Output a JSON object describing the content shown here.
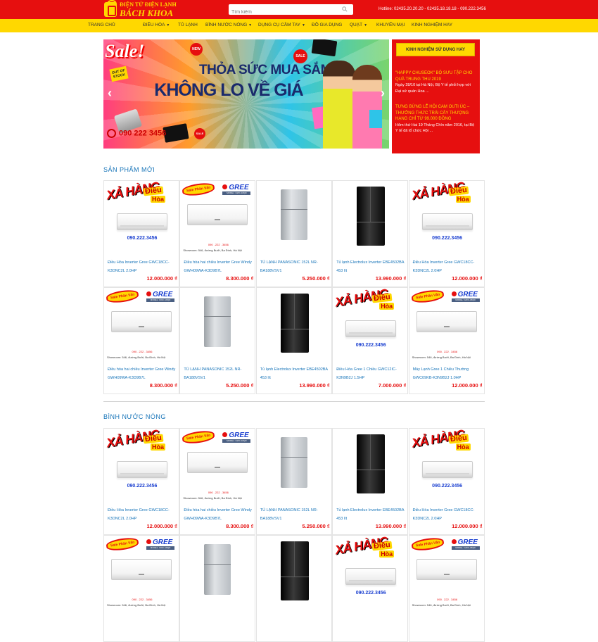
{
  "header": {
    "logo_line1": "ĐIỆN TỬ ĐIỆN LẠNH",
    "logo_line2": "BÁCH KHOA",
    "search_placeholder": "Tìm kiếm",
    "hotline": "Hotline: 02435.20.20.20 - 02435.18.18.18 - 090.222.3456"
  },
  "nav": [
    {
      "label": "Trang chủ",
      "caret": false
    },
    {
      "label": "Điều hòa",
      "caret": true
    },
    {
      "label": "Tủ lạnh",
      "caret": false
    },
    {
      "label": "Bình nước nóng",
      "caret": true
    },
    {
      "label": "Dụng cụ cầm tay",
      "caret": true
    },
    {
      "label": "Đồ gia dụng",
      "caret": false
    },
    {
      "label": "Quạt",
      "caret": true
    },
    {
      "label": "Khuyến mại",
      "caret": false
    },
    {
      "label": "Kinh nghiệm hay",
      "caret": false
    }
  ],
  "banner": {
    "sale": "Sale!",
    "out_of_stock": "OUT OF STOCK",
    "new": "NEW",
    "sale_badge": "SALE",
    "headline1": "THỎA SỨC MUA SẮM",
    "headline2": "KHÔNG LO VỀ GIÁ",
    "phone": "090 222 3456",
    "prev": "‹",
    "next": "›"
  },
  "sidebar": {
    "title": "Kinh nghiệm sử dụng hay",
    "news": [
      {
        "title": "\"Happy Chuseok\" bộ sưu tập cho quà Trung thu 2019",
        "desc": "Ngày 28/10 tại Hà Nội, Bộ Y tế phối hợp với Đại sứ quán Hoa ..."
      },
      {
        "title": "Tưng bừng lễ hội cam Outi Úc – thưởng thức trái cây thượng hạng chỉ từ 99.000 đồng",
        "desc": "Hôm thứ Hai 19 Tháng Chín năm 2016, tại Bộ Y tế đã tổ chức Hội ..."
      }
    ]
  },
  "sections": [
    {
      "title": "Sản phẩm mới",
      "products": [
        {
          "img": "promo",
          "name": "Điều Hòa Inverter Gree GWC18CC-K3DNC2L 2.0HP",
          "price": "12.000.000 ₫"
        },
        {
          "img": "gree-sale",
          "name": "Điều hòa hai chiều Inverter Gree Windy GWH09WA-K3D9B7L",
          "price": "8.300.000 ₫"
        },
        {
          "img": "fridge-silver",
          "name": "TỦ LẠNH PANASONIC 152L NR-BA188VSV1",
          "price": "5.250.000 ₫"
        },
        {
          "img": "fridge-black",
          "name": "Tủ lạnh Electrolux Inverter EBE4502BA 453 lít",
          "price": "13.990.000 ₫"
        },
        {
          "img": "promo",
          "name": "Điều Hòa Inverter Gree GWC18CC-K3DNC2L 2.0HP",
          "price": "12.000.000 ₫"
        },
        {
          "img": "gree-sale",
          "name": "Điều hòa hai chiều Inverter Gree Windy GWH09WA-K3D9B7L",
          "price": "8.300.000 ₫"
        },
        {
          "img": "fridge-silver",
          "name": "TỦ LẠNH PANASONIC 152L NR-BA188VSV1",
          "price": "5.250.000 ₫"
        },
        {
          "img": "fridge-black",
          "name": "Tủ lạnh Electrolux Inverter EBE4502BA 453 lít",
          "price": "13.990.000 ₫"
        },
        {
          "img": "promo",
          "name": "Điều Hòa Gree 1 Chiều GWC12IC-K3N9B2J 1.5HP",
          "price": "7.000.000 ₫"
        },
        {
          "img": "gree-sale",
          "name": "Máy Lạnh Gree 1 Chiều Thường GWC09KB-K3N9B2J 1.0HP",
          "price": "12.000.000 ₫"
        }
      ]
    },
    {
      "title": "Bình nước nóng",
      "products": [
        {
          "img": "promo",
          "name": "Điều Hòa Inverter Gree GWC18CC-K3DNC2L 2.0HP",
          "price": "12.000.000 ₫"
        },
        {
          "img": "gree-sale",
          "name": "Điều hòa hai chiều Inverter Gree Windy GWH09WA-K3D9B7L",
          "price": "8.300.000 ₫"
        },
        {
          "img": "fridge-silver",
          "name": "TỦ LẠNH PANASONIC 152L NR-BA188VSV1",
          "price": "5.250.000 ₫"
        },
        {
          "img": "fridge-black",
          "name": "Tủ lạnh Electrolux Inverter EBE4502BA 453 lít",
          "price": "13.990.000 ₫"
        },
        {
          "img": "promo",
          "name": "Điều Hòa Inverter Gree GWC18CC-K3DNC2L 2.0HP",
          "price": "12.000.000 ₫"
        },
        {
          "img": "gree-sale",
          "name": "",
          "price": ""
        },
        {
          "img": "fridge-silver",
          "name": "",
          "price": ""
        },
        {
          "img": "fridge-black",
          "name": "",
          "price": ""
        },
        {
          "img": "promo",
          "name": "",
          "price": ""
        },
        {
          "img": "gree-sale",
          "name": "",
          "price": ""
        }
      ]
    }
  ],
  "promo_image": {
    "xa_hang": "XẢ HÀNG",
    "dieu": "Điều",
    "hoa": "Hòa",
    "phone": "090.222.3456"
  },
  "gree_image": {
    "brand": "GREE",
    "model": "MODEL: GWC-18QD",
    "sale_pic": "Sale Phân Vân",
    "phone": "090 . 222 . 3456",
    "address": "Showroom: 546, đường Bưởi, Ba Đình, Hà Nội"
  },
  "colors": {
    "red": "#e60f0f",
    "yellow": "#ffd800",
    "link": "#1573b8"
  }
}
